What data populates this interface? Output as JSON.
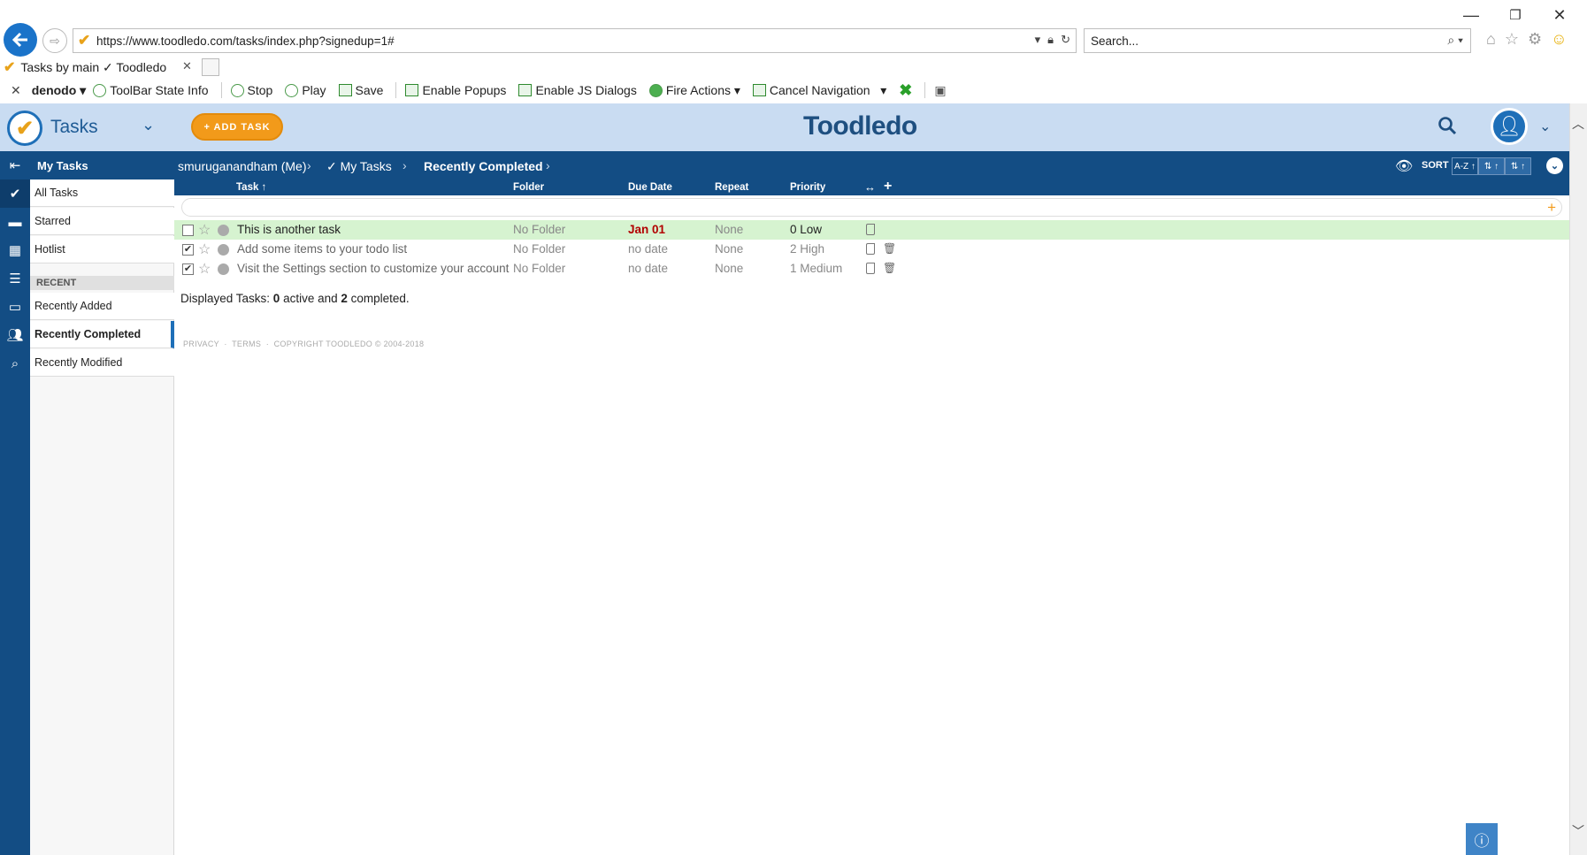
{
  "browser": {
    "url": "https://www.toodledo.com/tasks/index.php?signedup=1#",
    "search_placeholder": "Search...",
    "tab_title": "Tasks by main ✓ Toodledo",
    "win_min": "—",
    "win_restore": "❐",
    "win_close": "✕"
  },
  "toolbar": {
    "brand": "denodo",
    "state_info": "ToolBar State Info",
    "stop": "Stop",
    "play": "Play",
    "save": "Save",
    "enable_popups": "Enable Popups",
    "enable_js": "Enable JS Dialogs",
    "fire_actions": "Fire Actions",
    "cancel_nav": "Cancel Navigation"
  },
  "app": {
    "title": "Tasks",
    "add_task": "+ ADD TASK",
    "brand_left": "Toodle",
    "brand_right": "do"
  },
  "sidebar": {
    "header": "My Tasks",
    "items": [
      {
        "label": "All Tasks"
      },
      {
        "label": "Starred"
      },
      {
        "label": "Hotlist"
      }
    ],
    "recent_label": "RECENT",
    "recent_items": [
      {
        "label": "Recently Added"
      },
      {
        "label": "Recently Completed"
      },
      {
        "label": "Recently Modified"
      }
    ]
  },
  "breadcrumb": {
    "user": "smuruganandham (Me)",
    "list": "✓ My Tasks",
    "current": "Recently Completed",
    "sort_label": "SORT",
    "sort_az": "A-Z ↑",
    "sort_2": "⇅ ↑",
    "sort_3": "⇅ ↑"
  },
  "columns": {
    "task": "Task ↑",
    "folder": "Folder",
    "due": "Due Date",
    "repeat": "Repeat",
    "priority": "Priority"
  },
  "tasks": [
    {
      "title": "This is another task",
      "folder": "No Folder",
      "due": "Jan 01",
      "repeat": "None",
      "priority": "0 Low",
      "completed": false
    },
    {
      "title": "Add some items to your todo list",
      "folder": "No Folder",
      "due": "no date",
      "repeat": "None",
      "priority": "2 High",
      "completed": true
    },
    {
      "title": "Visit the Settings section to customize your account",
      "folder": "No Folder",
      "due": "no date",
      "repeat": "None",
      "priority": "1 Medium",
      "completed": true
    }
  ],
  "summary": {
    "prefix": "Displayed Tasks: ",
    "active": "0",
    "middle": " active and ",
    "completed": "2",
    "suffix": " completed."
  },
  "footer": {
    "privacy": "PRIVACY",
    "terms": "TERMS",
    "copyright": "COPYRIGHT TOODLEDO © 2004-2018"
  }
}
